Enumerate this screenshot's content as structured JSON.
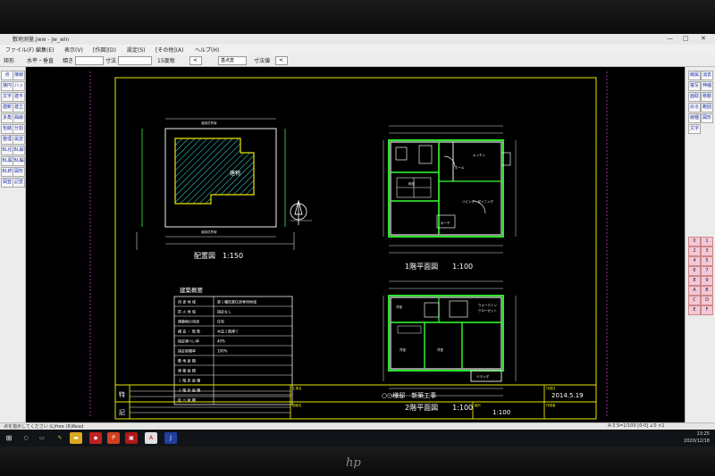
{
  "window": {
    "title": "敷地測量.jww - jw_win",
    "controls": [
      "—",
      "□",
      "✕"
    ]
  },
  "menu": [
    "ファイル(F)",
    "編集(E)",
    "表示(V)",
    "[作図](D)",
    "設定(S)",
    "[その他](A)",
    "ヘルプ(H)"
  ],
  "toolbar": [
    "矩形",
    "水平・垂直",
    "傾き",
    "寸法",
    "15度毎",
    "<",
    "基点変",
    "寸法値",
    "<"
  ],
  "left_tools": [
    "点",
    "接線",
    "接円",
    "ハッチ",
    "文字",
    "建平",
    "建断",
    "建立",
    "多角形",
    "曲線",
    "包絡",
    "分割",
    "整理",
    "属変",
    "BL化",
    "BL解",
    "BL属",
    "BL編",
    "BL終",
    "図形",
    "図登",
    "記変"
  ],
  "right_tools": [
    "線属",
    "消去",
    "複写",
    "伸縮",
    "面取",
    "移動",
    "戻る",
    "範囲",
    "線種",
    "図形",
    "文字"
  ],
  "right_layers": [
    "0",
    "1",
    "2",
    "3",
    "4",
    "5",
    "6",
    "7",
    "8",
    "9",
    "A",
    "B",
    "C",
    "D",
    "E",
    "F"
  ],
  "status": {
    "hint": "点を指示してください (L)free (R)Read",
    "scale": "A-3  S=1/100  [0-0]  ∠0  ×1"
  },
  "sheet": {
    "site_plan_label": "配置図　1:150",
    "building_label": "建物",
    "road_label": "道路境界線",
    "floor1_label": "1階平面図　　1:100",
    "floor2_label": "2階平面図　　1:100",
    "project_name": "○○様邸　新築工事",
    "date": "2014.5.19",
    "scale": "1:100",
    "special_notes": "特",
    "notes": "記",
    "rooms_1f": [
      "玄関",
      "ホール",
      "キッチン",
      "リビング・ダイニング",
      "和室",
      "ポーチ"
    ],
    "rooms_2f": [
      "洋室",
      "洋室",
      "洋室",
      "ウォークイン",
      "クローゼット",
      "ベランダ"
    ]
  },
  "building_overview": {
    "title": "建築概要",
    "rows": [
      [
        "用 途 地 域",
        "第１種低層住居専用地域"
      ],
      [
        "防 火 地 域",
        "指定なし"
      ],
      [
        "建築物の用途",
        "住宅"
      ],
      [
        "構 造 ・ 階 数",
        "木造２階建て"
      ],
      [
        "指定建ぺい率",
        "40%"
      ],
      [
        "指定容積率",
        "100%"
      ],
      [
        "敷 地 面 積",
        ""
      ],
      [
        "建 築 面 積",
        ""
      ],
      [
        "１ 階 床 面 積",
        ""
      ],
      [
        "２ 階 床 面 積",
        ""
      ],
      [
        "延 べ 面 積",
        ""
      ]
    ]
  },
  "title_block": {
    "project_label": "工事名",
    "drawing_label": "図面名",
    "scale_label": "縮尺",
    "date_label": "作図日",
    "drafter_label": "作図者"
  },
  "taskbar": {
    "time": "13:25",
    "date": "2020/12/18"
  },
  "colors": {
    "cad_bg": "#000000",
    "frame_yellow": "#e8e800",
    "line_white": "#f2f2f2",
    "wall_green": "#33ff33",
    "hatch_cyan": "#33e6e6",
    "dim_white": "#d8d8d8",
    "magenta": "#d040d0"
  }
}
